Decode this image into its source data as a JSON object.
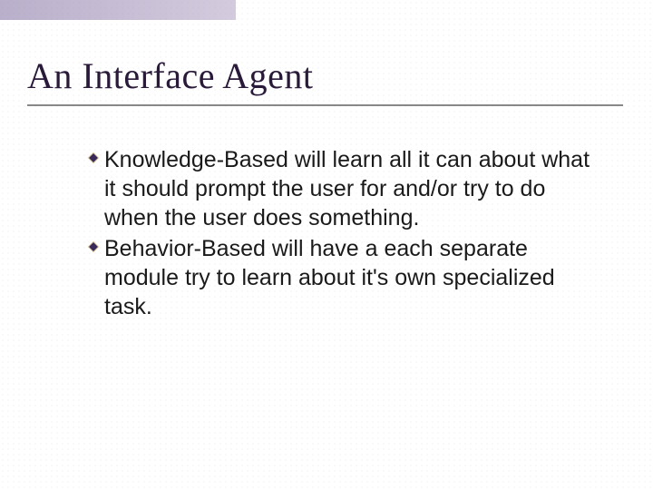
{
  "slide": {
    "title": "An Interface Agent",
    "bullets": [
      {
        "text": "Knowledge-Based will learn all it can about what it should prompt the user for and/or try to do when the user does something."
      },
      {
        "text": "Behavior-Based will have a each separate module try to learn about it's own specialized task."
      }
    ]
  }
}
